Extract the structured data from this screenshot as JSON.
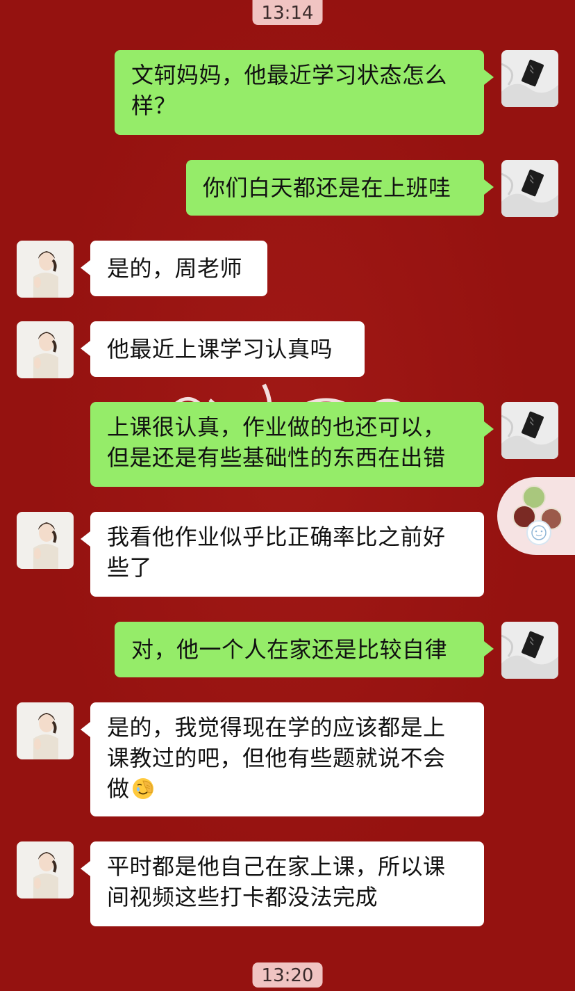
{
  "timestamps": {
    "top": "13:14",
    "bottom": "13:20"
  },
  "messages": [
    {
      "side": "right",
      "text_lines": [
        "文轲妈妈，他最近学习状态怎么",
        "样？"
      ]
    },
    {
      "side": "right",
      "text_lines": [
        "你们白天都还是在上班哇"
      ]
    },
    {
      "side": "left",
      "text_lines": [
        "是的，周老师"
      ]
    },
    {
      "side": "left",
      "text_lines": [
        "他最近上课学习认真吗"
      ]
    },
    {
      "side": "right",
      "text_lines": [
        "上课很认真，作业做的也还可以，",
        "但是还是有些基础性的东西在出错"
      ]
    },
    {
      "side": "left",
      "text_lines": [
        "我看他作业似乎比正确率比之前好",
        "些了"
      ]
    },
    {
      "side": "right",
      "text_lines": [
        "对，他一个人在家还是比较自律"
      ]
    },
    {
      "side": "left",
      "text_lines": [
        "是的，我觉得现在学的应该都是上",
        "课教过的吧，但他有些题就说不会",
        "做"
      ],
      "trailing_icon": "facepalm-emoji"
    },
    {
      "side": "left",
      "text_lines": [
        "平时都是他自己在家上课，所以课",
        "间视频这些打卡都没法完成"
      ]
    }
  ],
  "avatars": {
    "right": "teacher-avatar-icon",
    "left": "parent-avatar-icon"
  },
  "floating_widget": "floating-window-icon",
  "colors": {
    "background": "#951210",
    "sent_bubble": "#95ec69",
    "received_bubble": "#ffffff",
    "timestamp_bg": "#f0c4c2"
  }
}
